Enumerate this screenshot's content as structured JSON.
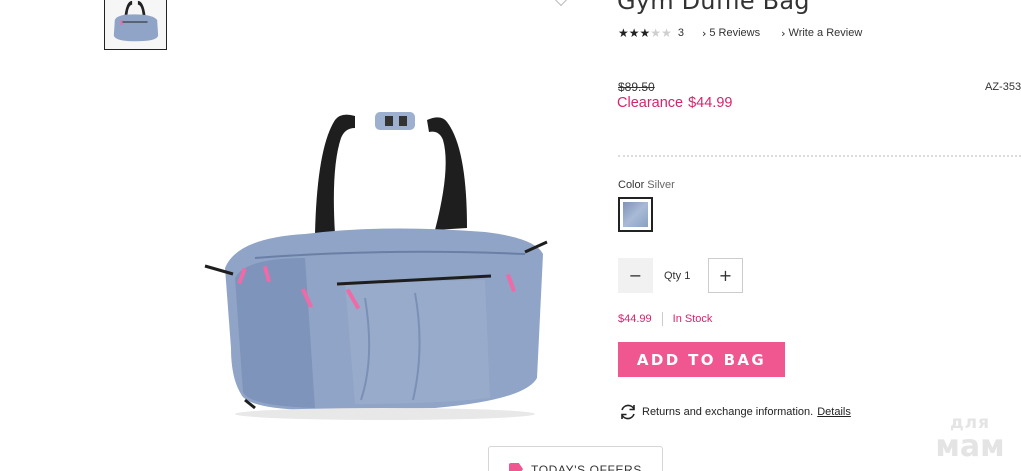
{
  "product": {
    "title": "Gym Duffle Bag",
    "rating": 3,
    "rating_max": 5,
    "rating_count": "3",
    "reviews_link": "5 Reviews",
    "write_review": "Write a Review",
    "original_price": "$89.50",
    "sku": "AZ-353",
    "clearance_label": "Clearance",
    "clearance_price": "$44.99",
    "color_label": "Color",
    "color_value": "Silver",
    "swatch_color": "#8fa4c6",
    "qty_label": "Qty",
    "qty_value": "1",
    "qty_minus": "−",
    "qty_plus": "+",
    "unit_price": "$44.99",
    "stock_status": "In Stock",
    "add_to_bag": "ADD TO BAG",
    "returns_text": "Returns and exchange information.",
    "details_link": "Details"
  },
  "offers": {
    "label": "TODAY'S OFFERS",
    "dots": "..."
  },
  "watermark": {
    "line1": "для",
    "line2": "мам"
  },
  "colors": {
    "accent_pink": "#d6246e",
    "button_pink": "#f0568f",
    "bag_body": "#8fa4c6"
  },
  "icons": {
    "star": "star-icon",
    "chevron": "chevron-right-icon",
    "returns": "refresh-icon"
  }
}
